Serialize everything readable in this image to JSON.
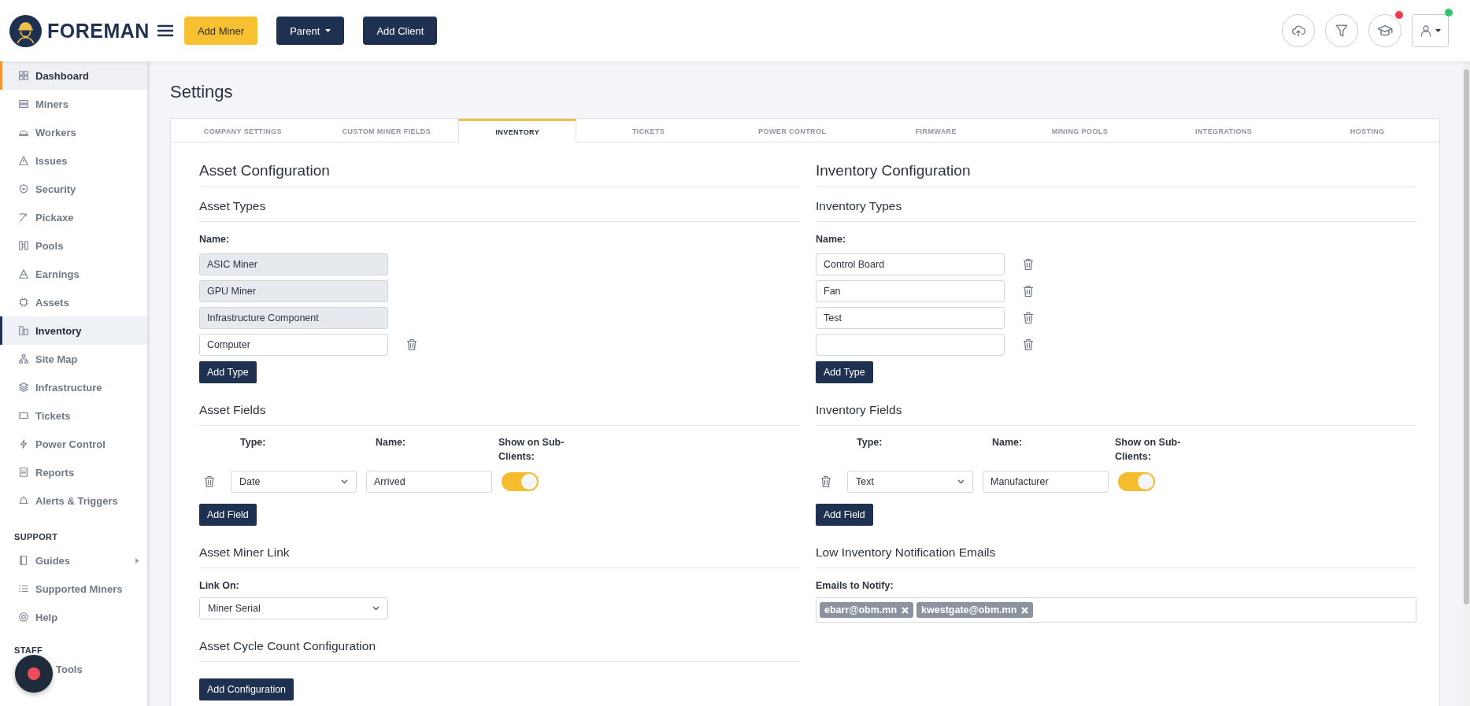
{
  "header": {
    "logo": "FOREMAN",
    "buttons": [
      {
        "label": "Add Miner",
        "kind": "accent"
      },
      {
        "label": "Parent",
        "kind": "dropdown"
      },
      {
        "label": "Add Client",
        "kind": "dark"
      }
    ],
    "actions": [
      {
        "kind": "upload"
      },
      {
        "kind": "filter"
      },
      {
        "kind": "learn",
        "color": "#ef3b4d"
      },
      {
        "kind": "user",
        "color": "#34c66b"
      }
    ]
  },
  "sidebar": {
    "sections": [
      {
        "items": [
          {
            "label": "Dashboard",
            "selected": false,
            "hovered": true,
            "expandable": false
          },
          {
            "label": "Miners",
            "selected": false,
            "hovered": false,
            "expandable": false
          },
          {
            "label": "Workers",
            "selected": false,
            "hovered": false,
            "expandable": false
          },
          {
            "label": "Issues",
            "selected": false,
            "hovered": false,
            "expandable": false
          },
          {
            "label": "Security",
            "selected": false,
            "hovered": false,
            "expandable": false
          },
          {
            "label": "Pickaxe",
            "selected": false,
            "hovered": false,
            "expandable": false
          },
          {
            "label": "Pools",
            "selected": false,
            "hovered": false,
            "expandable": false
          },
          {
            "label": "Earnings",
            "selected": false,
            "hovered": false,
            "expandable": false
          },
          {
            "label": "Assets",
            "selected": false,
            "hovered": false,
            "expandable": false
          },
          {
            "label": "Inventory",
            "selected": true,
            "hovered": false,
            "expandable": false
          },
          {
            "label": "Site Map",
            "selected": false,
            "hovered": false,
            "expandable": false
          },
          {
            "label": "Infrastructure",
            "selected": false,
            "hovered": false,
            "expandable": false
          },
          {
            "label": "Tickets",
            "selected": false,
            "hovered": false,
            "expandable": false
          },
          {
            "label": "Power Control",
            "selected": false,
            "hovered": false,
            "expandable": false
          },
          {
            "label": "Reports",
            "selected": false,
            "hovered": false,
            "expandable": false
          },
          {
            "label": "Alerts & Triggers",
            "selected": false,
            "hovered": false,
            "expandable": false
          }
        ]
      },
      {
        "heading": "SUPPORT",
        "items": [
          {
            "label": "Guides",
            "selected": false,
            "hovered": false,
            "expandable": true
          },
          {
            "label": "Supported Miners",
            "selected": false,
            "hovered": false,
            "expandable": false
          },
          {
            "label": "Help",
            "selected": false,
            "hovered": false,
            "expandable": false
          }
        ]
      },
      {
        "heading": "STAFF",
        "covered": true,
        "items": [
          {
            "label": "Tools",
            "selected": false,
            "hovered": false,
            "expandable": false
          }
        ]
      }
    ]
  },
  "page_title": "Settings",
  "tabs": [
    {
      "label": "COMPANY SETTINGS",
      "selected": false
    },
    {
      "label": "CUSTOM MINER FIELDS",
      "selected": false
    },
    {
      "label": "INVENTORY",
      "selected": true
    },
    {
      "label": "TICKETS",
      "selected": false
    },
    {
      "label": "POWER CONTROL",
      "selected": false
    },
    {
      "label": "FIRMWARE",
      "selected": false
    },
    {
      "label": "MINING POOLS",
      "selected": false
    },
    {
      "label": "INTEGRATIONS",
      "selected": false
    },
    {
      "label": "HOSTING",
      "selected": false
    }
  ],
  "columns": [
    {
      "title": "Asset Configuration",
      "types": {
        "title": "Asset Types",
        "label": "Name:",
        "button": "Add Type",
        "items": [
          {
            "value": "ASIC Miner",
            "disabled": true
          },
          {
            "value": "GPU Miner",
            "disabled": true
          },
          {
            "value": "Infrastructure Component",
            "disabled": true
          },
          {
            "value": "Computer",
            "disabled": false
          }
        ]
      },
      "fields": {
        "title": "Asset Fields",
        "columns": [
          "Type:",
          "Name:",
          "Show on Sub-Clients:"
        ],
        "button": "Add Field",
        "rows": [
          {
            "type": "Date",
            "name": "Arrived",
            "show_on_sub_clients": true
          }
        ]
      },
      "sections": [
        {
          "kind": "select",
          "title": "Asset Miner Link",
          "label": "Link On:",
          "value": "Miner Serial"
        },
        {
          "kind": "button",
          "title": "Asset Cycle Count Configuration",
          "button": "Add Configuration"
        }
      ]
    },
    {
      "title": "Inventory Configuration",
      "types": {
        "title": "Inventory Types",
        "label": "Name:",
        "button": "Add Type",
        "items": [
          {
            "value": "Control Board",
            "disabled": false
          },
          {
            "value": "Fan",
            "disabled": false
          },
          {
            "value": "Test",
            "disabled": false
          },
          {
            "disabled": false
          }
        ]
      },
      "fields": {
        "title": "Inventory Fields",
        "columns": [
          "Type:",
          "Name:",
          "Show on Sub-Clients:"
        ],
        "button": "Add Field",
        "rows": [
          {
            "type": "Text",
            "name": "Manufacturer",
            "show_on_sub_clients": true
          }
        ]
      },
      "sections": [
        {
          "kind": "emails",
          "title": "Low Inventory Notification Emails",
          "label": "Emails to Notify:",
          "emails": [
            "ebarr@obm.mn",
            "kwestgate@obm.mn"
          ]
        }
      ]
    }
  ]
}
